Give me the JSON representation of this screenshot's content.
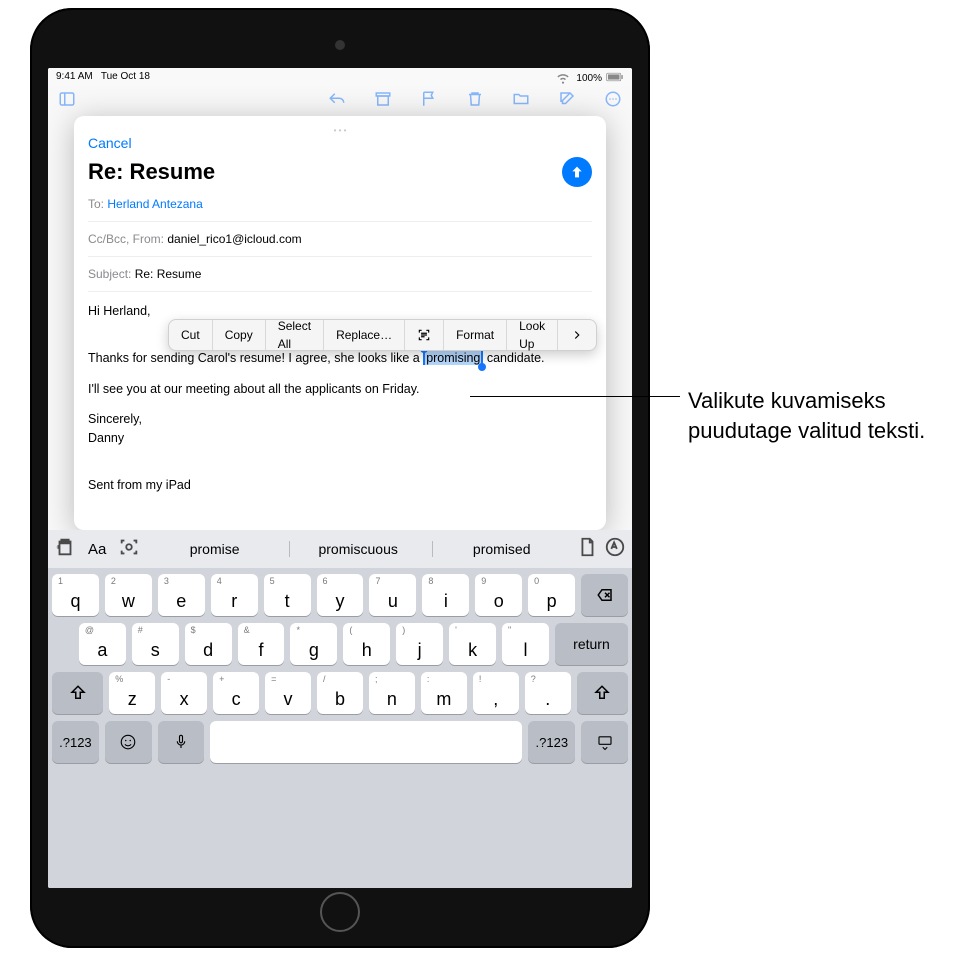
{
  "status": {
    "time": "9:41 AM",
    "date": "Tue Oct 18",
    "battery": "100%"
  },
  "compose": {
    "cancel": "Cancel",
    "title": "Re: Resume",
    "to_label": "To:",
    "to_value": "Herland Antezana",
    "cc_label": "Cc/Bcc, From:",
    "cc_value": "daniel_rico1@icloud.com",
    "subject_label": "Subject:",
    "subject_value": "Re: Resume",
    "greeting": "Hi Herland,",
    "line1a": "Thanks for sending Carol's resume! I agree, she looks like a ",
    "selected_word": "promising",
    "line1b": " candidate.",
    "line2": "I'll see you at our meeting about all the applicants on Friday.",
    "signoff": "Sincerely,",
    "name": "Danny",
    "footer": "Sent from my iPad"
  },
  "popup": {
    "cut": "Cut",
    "copy": "Copy",
    "selectall": "Select All",
    "replace": "Replace…",
    "format": "Format",
    "lookup": "Look Up"
  },
  "suggestions": [
    "promise",
    "promiscuous",
    "promised"
  ],
  "keys": {
    "row1": [
      {
        "main": "q",
        "sub": "1"
      },
      {
        "main": "w",
        "sub": "2"
      },
      {
        "main": "e",
        "sub": "3"
      },
      {
        "main": "r",
        "sub": "4"
      },
      {
        "main": "t",
        "sub": "5"
      },
      {
        "main": "y",
        "sub": "6"
      },
      {
        "main": "u",
        "sub": "7"
      },
      {
        "main": "i",
        "sub": "8"
      },
      {
        "main": "o",
        "sub": "9"
      },
      {
        "main": "p",
        "sub": "0"
      }
    ],
    "row2": [
      {
        "main": "a",
        "sub": "@"
      },
      {
        "main": "s",
        "sub": "#"
      },
      {
        "main": "d",
        "sub": "$"
      },
      {
        "main": "f",
        "sub": "&"
      },
      {
        "main": "g",
        "sub": "*"
      },
      {
        "main": "h",
        "sub": "("
      },
      {
        "main": "j",
        "sub": ")"
      },
      {
        "main": "k",
        "sub": "'"
      },
      {
        "main": "l",
        "sub": "\""
      }
    ],
    "row3": [
      {
        "main": "z",
        "sub": "%"
      },
      {
        "main": "x",
        "sub": "-"
      },
      {
        "main": "c",
        "sub": "+"
      },
      {
        "main": "v",
        "sub": "="
      },
      {
        "main": "b",
        "sub": "/"
      },
      {
        "main": "n",
        "sub": ";"
      },
      {
        "main": "m",
        "sub": ":"
      },
      {
        "main": ",",
        "sub": "!"
      },
      {
        "main": ".",
        "sub": "?"
      }
    ],
    "return": "return",
    "numkey": ".?123"
  },
  "callout": "Valikute kuvamiseks puudutage valitud teksti."
}
